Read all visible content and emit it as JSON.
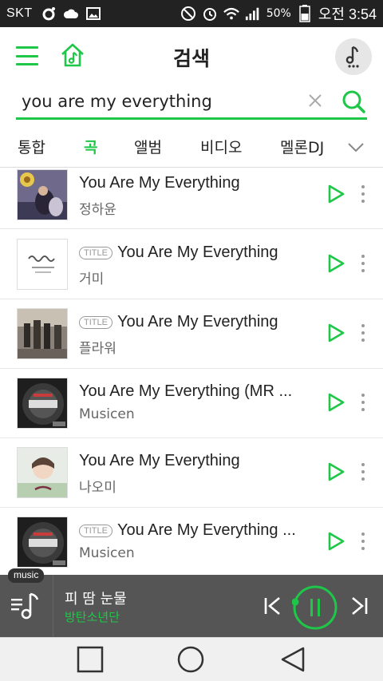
{
  "status_bar": {
    "carrier": "SKT",
    "battery": "50%",
    "time": "오전 3:54"
  },
  "header": {
    "title": "검색"
  },
  "search": {
    "value": "you are my everything"
  },
  "tabs": [
    {
      "label": "통합",
      "active": false
    },
    {
      "label": "곡",
      "active": true
    },
    {
      "label": "앨범",
      "active": false
    },
    {
      "label": "비디오",
      "active": false
    },
    {
      "label": "멜론DJ",
      "active": false
    }
  ],
  "songs": [
    {
      "title": "You Are My Everything",
      "artist": "정하윤",
      "badge": ""
    },
    {
      "title": "You Are My Everything",
      "artist": "거미",
      "badge": "TITLE"
    },
    {
      "title": "You Are My Everything",
      "artist": "플라워",
      "badge": "TITLE"
    },
    {
      "title": "You Are My Everything (MR ...",
      "artist": "Musicen",
      "badge": ""
    },
    {
      "title": "You Are My Everything",
      "artist": "나오미",
      "badge": ""
    },
    {
      "title": "You Are My Everything ...",
      "artist": "Musicen",
      "badge": "TITLE"
    }
  ],
  "player": {
    "badge": "music",
    "title": "피 땀 눈물",
    "artist": "방탄소년단"
  },
  "colors": {
    "accent": "#1ec748",
    "player_bg": "#555555",
    "status_bg": "#222222"
  }
}
